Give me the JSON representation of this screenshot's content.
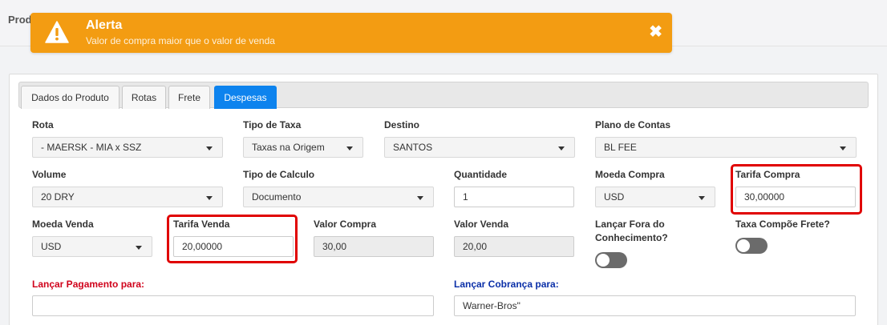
{
  "page": {
    "title": "Prod"
  },
  "alert": {
    "title": "Alerta",
    "message": "Valor de compra maior que o valor de venda",
    "close": "✖",
    "color": "#f39c12"
  },
  "tabs": [
    {
      "label": "Dados do Produto"
    },
    {
      "label": "Rotas"
    },
    {
      "label": "Frete"
    },
    {
      "label": "Despesas",
      "active": true
    }
  ],
  "form": {
    "rota": {
      "label": "Rota",
      "value": "- MAERSK - MIA x SSZ"
    },
    "tipo_taxa": {
      "label": "Tipo de Taxa",
      "value": "Taxas na Origem"
    },
    "destino": {
      "label": "Destino",
      "value": "SANTOS"
    },
    "plano_contas": {
      "label": "Plano de Contas",
      "value": "BL FEE"
    },
    "volume": {
      "label": "Volume",
      "value": "20 DRY"
    },
    "tipo_calculo": {
      "label": "Tipo de Calculo",
      "value": "Documento"
    },
    "quantidade": {
      "label": "Quantidade",
      "value": "1"
    },
    "moeda_compra": {
      "label": "Moeda Compra",
      "value": "USD"
    },
    "tarifa_compra": {
      "label": "Tarifa Compra",
      "value": "30,00000"
    },
    "moeda_venda": {
      "label": "Moeda Venda",
      "value": "USD"
    },
    "tarifa_venda": {
      "label": "Tarifa Venda",
      "value": "20,00000"
    },
    "valor_compra": {
      "label": "Valor Compra",
      "value": "30,00"
    },
    "valor_venda": {
      "label": "Valor Venda",
      "value": "20,00"
    },
    "lancar_fora": {
      "label": "Lançar Fora do Conhecimento?",
      "on": false
    },
    "taxa_compoe": {
      "label": "Taxa Compõe Frete?",
      "on": false
    },
    "lancar_pagamento": {
      "label": "Lançar Pagamento para:",
      "value": ""
    },
    "lancar_cobranca": {
      "label": "Lançar Cobrança para:",
      "value": "Warner-Bros\""
    }
  },
  "colors": {
    "tab_active": "#0d83ee",
    "highlight": "#e00000",
    "label_red": "#d0021b",
    "label_blue": "#0a2fa8"
  }
}
